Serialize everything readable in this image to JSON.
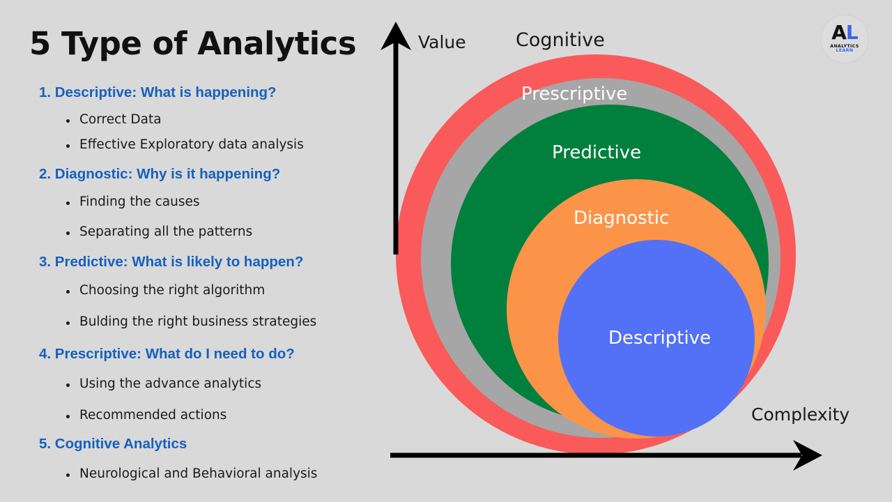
{
  "title": "5 Type of Analytics",
  "colors": {
    "background": "#d9d9d9",
    "heading_blue": "#1560bd",
    "body_text": "#1a1a1a",
    "ring_cognitive": "#fa5a5a",
    "ring_prescriptive": "#a6a6a6",
    "ring_predictive": "#00803c",
    "ring_diagnostic": "#fb9449",
    "ring_descriptive": "#5271f7",
    "axis": "#000000",
    "logo_blue": "#3b63f0"
  },
  "sections": [
    {
      "heading": "1. Descriptive: What is happening?",
      "bullets": [
        "Correct Data",
        "Effective Exploratory data analysis"
      ]
    },
    {
      "heading": "2. Diagnostic: Why is it happening?",
      "bullets": [
        "Finding the causes",
        "Separating all the patterns"
      ]
    },
    {
      "heading": "3. Predictive: What is likely to happen?",
      "bullets": [
        "Choosing the right algorithm",
        "Bulding the right business strategies"
      ]
    },
    {
      "heading": "4. Prescriptive: What do I need to do?",
      "bullets": [
        "Using the advance analytics",
        " Recommended actions"
      ]
    },
    {
      "heading": "5. Cognitive Analytics",
      "bullets": [
        "Neurological and Behavioral analysis"
      ]
    }
  ],
  "diagram": {
    "axes": {
      "vertical_label": "Value",
      "horizontal_label": "Complexity"
    },
    "rings": [
      {
        "label": "Cognitive",
        "color": "#fa5a5a",
        "label_color": "#1a1a1a"
      },
      {
        "label": "Prescriptive",
        "color": "#a6a6a6",
        "label_color": "#ffffff"
      },
      {
        "label": "Predictive",
        "color": "#00803c",
        "label_color": "#ffffff"
      },
      {
        "label": "Diagnostic",
        "color": "#fb9449",
        "label_color": "#ffffff"
      },
      {
        "label": "Descriptive",
        "color": "#5271f7",
        "label_color": "#ffffff"
      }
    ]
  },
  "logo": {
    "mark_first": "A",
    "mark_second": "L",
    "sub_first": "ANALYTICS",
    "sub_second": "LEARN"
  }
}
